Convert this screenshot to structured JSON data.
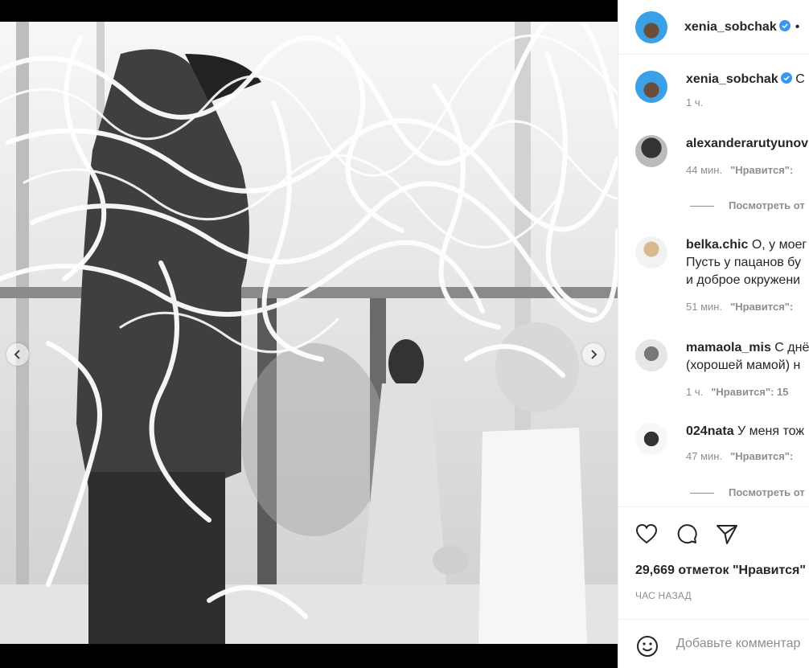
{
  "post": {
    "author": "xenia_sobchak",
    "dot": "•",
    "caption_start": "С",
    "caption_time": "1 ч."
  },
  "comments": [
    {
      "user": "alexanderarutyunov",
      "text": "",
      "time": "44 мин.",
      "like_label": "\"Нравится\":",
      "avatar": "dark"
    },
    {
      "user": "belka.chic",
      "text": "О, у моег",
      "line2": "Пусть у пацанов бу",
      "line3": "и доброе окружени",
      "time": "51 мин.",
      "like_label": "\"Нравится\":",
      "avatar": "light"
    },
    {
      "user": "mamaola_mis",
      "text": "С днё",
      "line2": "(хорошей мамой) н",
      "time": "1 ч.",
      "like_label": "\"Нравится\": 15",
      "avatar": "gray"
    },
    {
      "user": "024nata",
      "text": "У меня тож",
      "time": "47 мин.",
      "like_label": "\"Нравится\":",
      "avatar": "white"
    }
  ],
  "view_replies": "Посмотреть от",
  "likes": "29,669 отметок \"Нравится\"",
  "time_ago": "ЧАС НАЗАД",
  "comment_placeholder": "Добавьте комментар",
  "colors": {
    "verified": "#3897f0",
    "text": "#262626",
    "muted": "#8e8e8e",
    "divider": "#efefef"
  },
  "icons": [
    "heart-icon",
    "comment-icon",
    "share-icon",
    "emoji-icon",
    "chevron-left-icon",
    "chevron-right-icon",
    "verified-icon"
  ]
}
